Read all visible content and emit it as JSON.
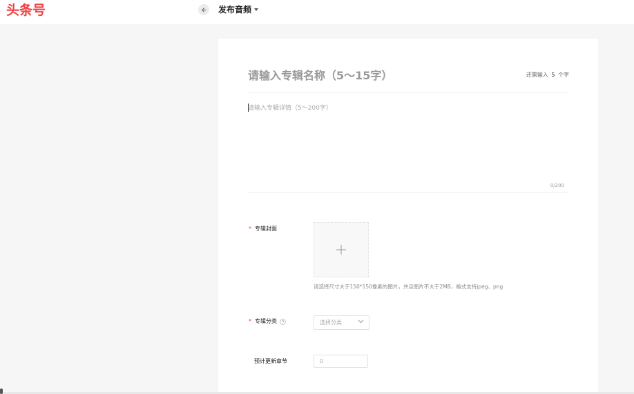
{
  "header": {
    "logo": "头条号",
    "title": "发布音频"
  },
  "album": {
    "name_placeholder": "请输入专辑名称（5～15字）",
    "remain_prefix": "还需输入",
    "remain_count": "5",
    "remain_suffix": "个字",
    "desc_placeholder": "请输入专辑详情（5～200字）",
    "desc_count": "0/200"
  },
  "cover": {
    "label": "专辑封面",
    "required_mark": "*",
    "hint": "请选择尺寸大于150*150像素的图片，并且图片不大于2MB，格式支持jpeg、png"
  },
  "category": {
    "label": "专辑分类",
    "required_mark": "*",
    "placeholder": "选择分类"
  },
  "chapters": {
    "label": "预计更新章节",
    "placeholder": "0"
  },
  "colors": {
    "brand": "#f04142",
    "required": "#f04142",
    "placeholder": "#999999"
  }
}
